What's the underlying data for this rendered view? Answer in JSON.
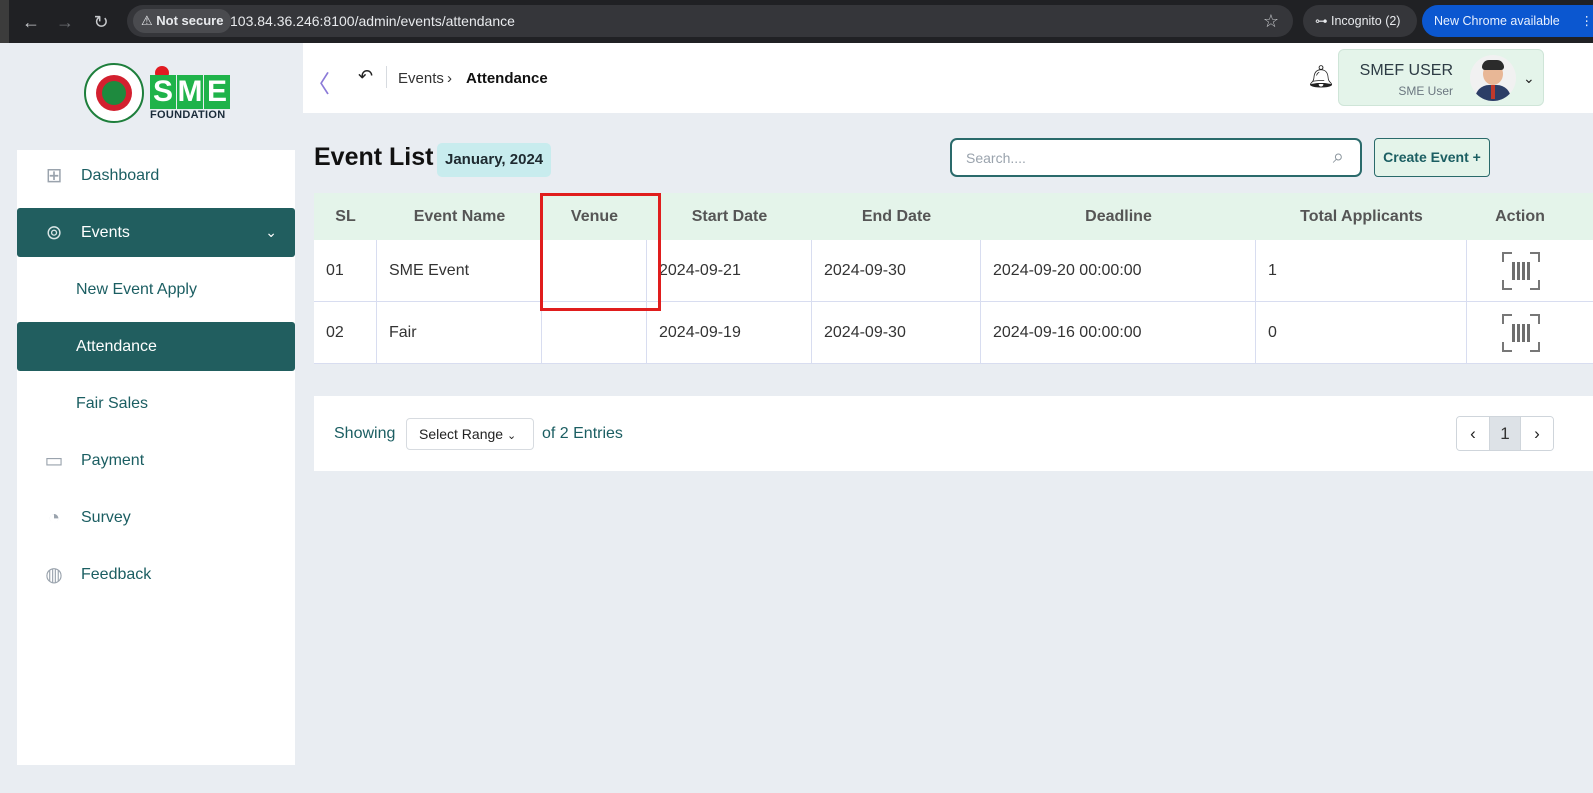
{
  "browser": {
    "security_label": "Not secure",
    "url": "103.84.36.246:8100/admin/events/attendance",
    "incognito_label": "Incognito (2)",
    "update_label": "New Chrome available"
  },
  "brand": {
    "logo_letters": [
      "S",
      "M",
      "E"
    ],
    "logo_subtitle": "FOUNDATION"
  },
  "sidebar": {
    "items": [
      {
        "label": "Dashboard",
        "icon": "grid-icon"
      },
      {
        "label": "Events",
        "icon": "lock-icon"
      },
      {
        "label": "New Event Apply"
      },
      {
        "label": "Attendance"
      },
      {
        "label": "Fair Sales"
      },
      {
        "label": "Payment",
        "icon": "money-icon"
      },
      {
        "label": "Survey",
        "icon": "pie-chart-icon"
      },
      {
        "label": "Feedback",
        "icon": "feedback-icon"
      }
    ]
  },
  "header": {
    "breadcrumb": [
      "Events",
      "Attendance"
    ],
    "user_name": "SMEF USER",
    "user_role": "SME User"
  },
  "main": {
    "title": "Event List",
    "month_badge": "January, 2024",
    "search_placeholder": "Search....",
    "create_button": "Create Event +"
  },
  "table": {
    "columns": [
      "SL",
      "Event Name",
      "Venue",
      "Start Date",
      "End Date",
      "Deadline",
      "Total Applicants",
      "Action"
    ],
    "rows": [
      {
        "sl": "01",
        "name": "SME Event",
        "venue": "",
        "start": "2024-09-21",
        "end": "2024-09-30",
        "deadline": "2024-09-20 00:00:00",
        "applicants": "1"
      },
      {
        "sl": "02",
        "name": "Fair",
        "venue": "",
        "start": "2024-09-19",
        "end": "2024-09-30",
        "deadline": "2024-09-16 00:00:00",
        "applicants": "0"
      }
    ]
  },
  "pagination": {
    "showing_label": "Showing",
    "range_label": "Select Range",
    "entries_label": "of 2 Entries",
    "current_page": "1"
  },
  "colors": {
    "primary": "#215e5f",
    "header_bg": "#e4f4ea",
    "highlight": "#e01d1d"
  }
}
